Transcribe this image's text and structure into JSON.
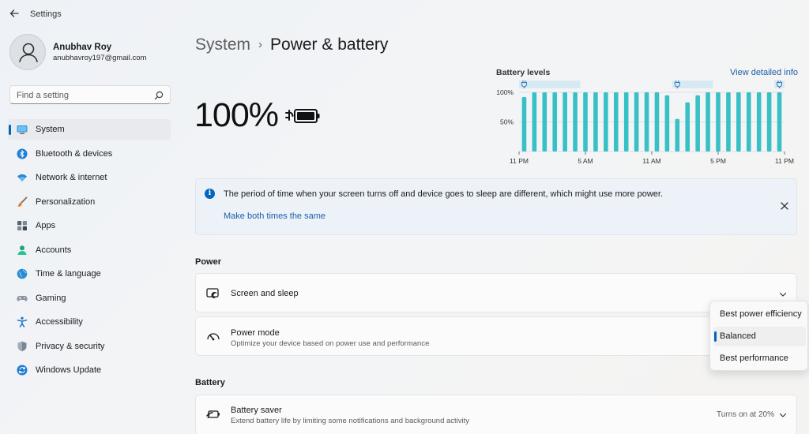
{
  "window": {
    "title": "Settings"
  },
  "profile": {
    "name": "Anubhav Roy",
    "email": "anubhavroy197@gmail.com"
  },
  "search": {
    "placeholder": "Find a setting",
    "value": ""
  },
  "sidebar": {
    "items": [
      {
        "label": "System",
        "icon": "system-icon",
        "active": true
      },
      {
        "label": "Bluetooth & devices",
        "icon": "bluetooth-icon"
      },
      {
        "label": "Network & internet",
        "icon": "wifi-icon"
      },
      {
        "label": "Personalization",
        "icon": "brush-icon"
      },
      {
        "label": "Apps",
        "icon": "apps-icon"
      },
      {
        "label": "Accounts",
        "icon": "person-icon"
      },
      {
        "label": "Time & language",
        "icon": "globe-icon"
      },
      {
        "label": "Gaming",
        "icon": "gamepad-icon"
      },
      {
        "label": "Accessibility",
        "icon": "accessibility-icon"
      },
      {
        "label": "Privacy & security",
        "icon": "shield-icon"
      },
      {
        "label": "Windows Update",
        "icon": "update-icon"
      }
    ]
  },
  "header": {
    "parent": "System",
    "separator": "›",
    "current": "Power & battery"
  },
  "battery": {
    "percent": "100%",
    "icon": "battery-charging-icon"
  },
  "chart_data": {
    "type": "bar",
    "title": "Battery levels",
    "link": "View detailed info",
    "y_ticks": [
      "100%",
      "50%"
    ],
    "x_ticks": [
      "11 PM",
      "5 AM",
      "11 AM",
      "5 PM",
      "11 PM"
    ],
    "ylim": [
      0,
      100
    ],
    "values": [
      92,
      100,
      100,
      100,
      100,
      100,
      100,
      100,
      100,
      100,
      100,
      100,
      100,
      100,
      95,
      55,
      83,
      95,
      100,
      100,
      100,
      100,
      100,
      100,
      100,
      100
    ],
    "plugged_in_ranges": [
      [
        0,
        5
      ],
      [
        15,
        18
      ],
      [
        25,
        25
      ]
    ],
    "grid": true,
    "colors": {
      "bar": "#38c0c6",
      "plug": "#3a78b8",
      "plug_band": "#d7eaf3"
    }
  },
  "banner": {
    "icon": "info-icon",
    "message": "The period of time when your screen turns off and device goes to sleep are different, which might use more power.",
    "link": "Make both times the same",
    "close_icon": "close-icon"
  },
  "sections": {
    "power": {
      "title": "Power",
      "screen_sleep": {
        "title": "Screen and sleep",
        "icon": "screen-sleep-icon"
      },
      "power_mode": {
        "title": "Power mode",
        "subtitle": "Optimize your device based on power use and performance",
        "icon": "gauge-icon",
        "options": [
          "Best power efficiency",
          "Balanced",
          "Best performance"
        ],
        "selected": "Balanced"
      }
    },
    "battery": {
      "title": "Battery",
      "battery_saver": {
        "title": "Battery saver",
        "subtitle": "Extend battery life by limiting some notifications and background activity",
        "value": "Turns on at 20%",
        "icon": "battery-saver-icon"
      }
    }
  },
  "theme": {
    "accent": "#0067c0",
    "link": "#1a5fa8"
  }
}
